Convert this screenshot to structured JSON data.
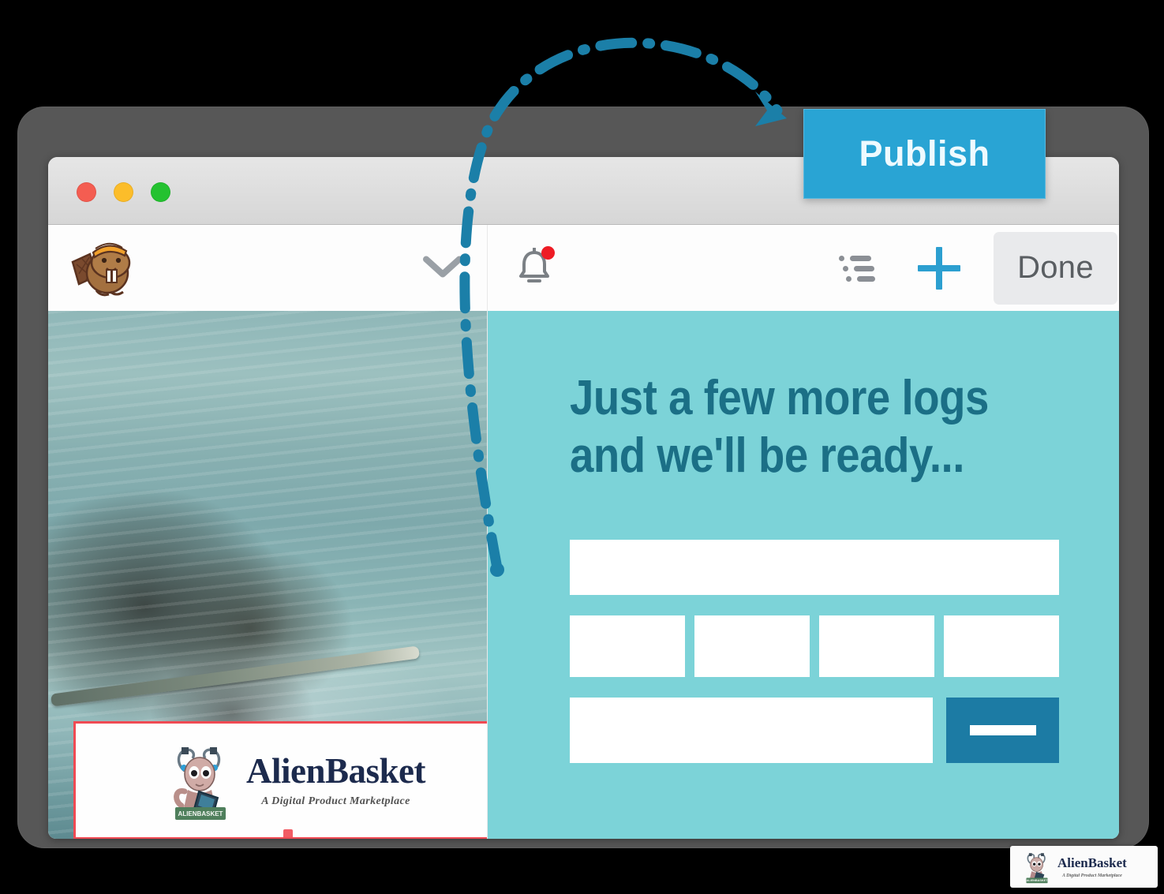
{
  "annotation": {
    "publish_button_label": "Publish",
    "arrow_icon": "curved-dash-dot-arrow",
    "accent_color": "#1b7fa8",
    "publish_bg": "#29a4d4"
  },
  "window": {
    "traffic_lights": [
      {
        "name": "close",
        "color": "#f45d51"
      },
      {
        "name": "minimize",
        "color": "#fcbd2a"
      },
      {
        "name": "zoom",
        "color": "#24c230"
      }
    ]
  },
  "toolbar": {
    "logo_icon": "beaver-builder-logo",
    "chevron_icon": "chevron-down-icon",
    "bell_icon": "notification-bell-icon",
    "bell_badge": "",
    "list_icon": "outline-list-icon",
    "add_icon": "plus-icon",
    "done_label": "Done"
  },
  "editor": {
    "left_panel": {
      "photo_alt": "beaver-swimming-with-branch-photo",
      "logo_row": {
        "logo_icon": "alienbasket-alien-logo",
        "title": "AlienBasket",
        "tagline": "A Digital Product Marketplace",
        "selection_color": "#f04a53"
      }
    },
    "right_panel": {
      "background_color": "#7cd3d8",
      "heading_line1": "Just a few more logs",
      "heading_line2": "and we'll be ready...",
      "heading_color": "#1b6f86",
      "form": {
        "row1_fields": 1,
        "row2_fields": 4,
        "row3_input_fields": 1,
        "submit_button_color": "#1c7ba4",
        "submit_icon": "minus-bar-icon"
      }
    }
  },
  "watermark": {
    "logo_icon": "alienbasket-alien-logo",
    "title": "AlienBasket",
    "tagline": "A Digital Product Marketplace"
  }
}
